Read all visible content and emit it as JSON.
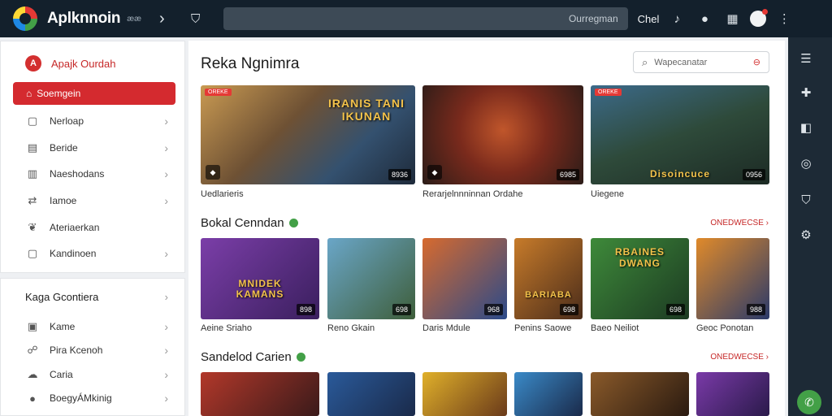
{
  "topbar": {
    "title": "Aplknnoin",
    "subtitle": "ææ",
    "search_placeholder": "Ourregman",
    "action_label": "Chel"
  },
  "sidebar": {
    "header": "Apajk Ourdah",
    "active_item": "Soemgein",
    "items": [
      {
        "label": "Nerloap",
        "icon": "square-icon"
      },
      {
        "label": "Beride",
        "icon": "document-icon"
      },
      {
        "label": "Naeshodans",
        "icon": "folder-icon"
      },
      {
        "label": "Iamoe",
        "icon": "transfer-icon"
      },
      {
        "label": "Ateriaerkan",
        "icon": "leaf-icon"
      },
      {
        "label": "Kandinoen",
        "icon": "square-icon"
      }
    ],
    "group_title": "Kaga Gcontiera",
    "group_items": [
      {
        "label": "Kame",
        "icon": "image-icon"
      },
      {
        "label": "Pira Kcenoh",
        "icon": "people-icon"
      },
      {
        "label": "Caria",
        "icon": "cloud-icon"
      },
      {
        "label": "BoegyÁMkinig",
        "icon": "disc-icon"
      }
    ]
  },
  "main": {
    "page_title": "Reka Ngnimra",
    "filter_placeholder": "Wapecanatar",
    "featured": [
      {
        "title_overlay": "IRANIS TANI\nIKUNAN",
        "duration": "8936",
        "caption": "Uedlarieris",
        "tag": "OREKE"
      },
      {
        "title_overlay": "",
        "duration": "6985",
        "caption": "Rerarjelnnninnan Ordahe",
        "tag": ""
      },
      {
        "title_overlay": "Disoincuce",
        "duration": "0956",
        "caption": "Uiegene",
        "tag": "OREKE"
      }
    ],
    "section1": {
      "title": "Bokal Cenndan",
      "see_more": "ONEDWECSE",
      "cards": [
        {
          "overlay": "MNIDEK\nKAMANS",
          "duration": "898",
          "caption": "Aeine Sriaho"
        },
        {
          "overlay": "",
          "duration": "698",
          "caption": "Reno Gkain"
        },
        {
          "overlay": "",
          "duration": "968",
          "caption": "Daris Mdule"
        },
        {
          "overlay": "BARIABA",
          "duration": "698",
          "caption": "Penins Saowe"
        },
        {
          "overlay": "RBAINES\nDWANG",
          "duration": "698",
          "caption": "Baeo Neiliot"
        },
        {
          "overlay": "",
          "duration": "988",
          "caption": "Geoc Ponotan"
        }
      ]
    },
    "section2": {
      "title": "Sandelod Carien",
      "see_more": "ONEDWECSE"
    }
  },
  "rail": {
    "icons": [
      "list-icon",
      "puzzle-icon",
      "panel-icon",
      "globe-icon",
      "shield-icon",
      "gear-icon"
    ]
  }
}
